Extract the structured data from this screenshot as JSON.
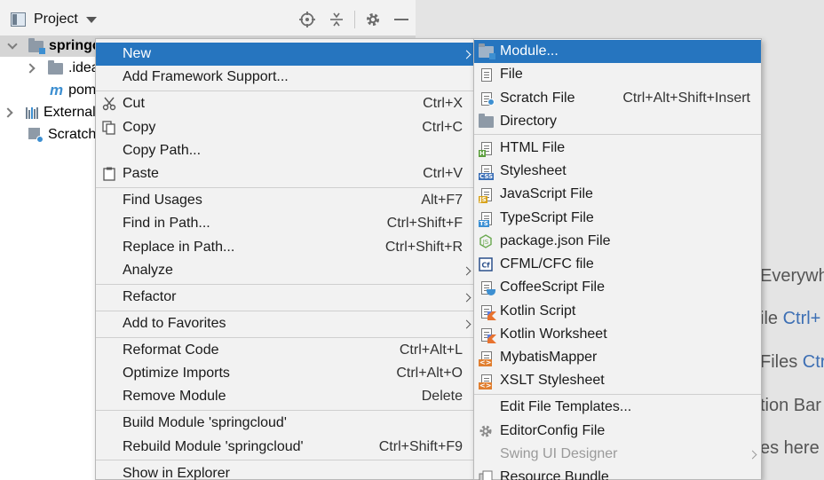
{
  "panel": {
    "title": "Project"
  },
  "tree": [
    {
      "label": "springcloud",
      "bold": true
    },
    {
      "label": ".idea"
    },
    {
      "label": "pom"
    },
    {
      "label": "External"
    },
    {
      "label": "Scratch"
    }
  ],
  "hints": [
    {
      "text": "Everywh",
      "key": ""
    },
    {
      "text": "ile ",
      "key": "Ctrl+"
    },
    {
      "text": "Files ",
      "key": "Ctr"
    },
    {
      "text": "tion Bar",
      "key": ""
    },
    {
      "text": "es here",
      "key": ""
    }
  ],
  "context_menu": {
    "items": [
      {
        "label": "New",
        "shortcut": "",
        "submenu": true,
        "highlighted": true
      },
      {
        "label": "Add Framework Support...",
        "shortcut": ""
      },
      {
        "label": "Cut",
        "shortcut": "Ctrl+X",
        "icon": "scissors-icon"
      },
      {
        "label": "Copy",
        "shortcut": "Ctrl+C",
        "icon": "copy-icon"
      },
      {
        "label": "Copy Path...",
        "shortcut": ""
      },
      {
        "label": "Paste",
        "shortcut": "Ctrl+V",
        "icon": "clipboard-icon"
      },
      {
        "label": "Find Usages",
        "shortcut": "Alt+F7"
      },
      {
        "label": "Find in Path...",
        "shortcut": "Ctrl+Shift+F"
      },
      {
        "label": "Replace in Path...",
        "shortcut": "Ctrl+Shift+R"
      },
      {
        "label": "Analyze",
        "shortcut": "",
        "submenu": true
      },
      {
        "label": "Refactor",
        "shortcut": "",
        "submenu": true
      },
      {
        "label": "Add to Favorites",
        "shortcut": "",
        "submenu": true
      },
      {
        "label": "Reformat Code",
        "shortcut": "Ctrl+Alt+L"
      },
      {
        "label": "Optimize Imports",
        "shortcut": "Ctrl+Alt+O"
      },
      {
        "label": "Remove Module",
        "shortcut": "Delete"
      },
      {
        "label": "Build Module 'springcloud'",
        "shortcut": ""
      },
      {
        "label": "Rebuild Module 'springcloud'",
        "shortcut": "Ctrl+Shift+F9"
      },
      {
        "label": "Show in Explorer",
        "shortcut": ""
      }
    ]
  },
  "new_submenu": {
    "items": [
      {
        "label": "Module...",
        "shortcut": "",
        "highlighted": true,
        "icon": "module-folder-icon"
      },
      {
        "label": "File",
        "shortcut": "",
        "icon": "file-icon"
      },
      {
        "label": "Scratch File",
        "shortcut": "Ctrl+Alt+Shift+Insert",
        "icon": "scratch-file-icon"
      },
      {
        "label": "Directory",
        "shortcut": "",
        "icon": "folder-icon"
      },
      {
        "label": "HTML File",
        "shortcut": "",
        "icon": "html-file-icon",
        "tag": "H"
      },
      {
        "label": "Stylesheet",
        "shortcut": "",
        "icon": "css-file-icon",
        "tag": "CSS"
      },
      {
        "label": "JavaScript File",
        "shortcut": "",
        "icon": "js-file-icon",
        "tag": "JS"
      },
      {
        "label": "TypeScript File",
        "shortcut": "",
        "icon": "ts-file-icon",
        "tag": "TS"
      },
      {
        "label": "package.json File",
        "shortcut": "",
        "icon": "nodejs-icon"
      },
      {
        "label": "CFML/CFC file",
        "shortcut": "",
        "icon": "cfml-icon"
      },
      {
        "label": "CoffeeScript File",
        "shortcut": "",
        "icon": "coffeescript-icon"
      },
      {
        "label": "Kotlin Script",
        "shortcut": "",
        "icon": "kotlin-icon"
      },
      {
        "label": "Kotlin Worksheet",
        "shortcut": "",
        "icon": "kotlin-icon"
      },
      {
        "label": "MybatisMapper",
        "shortcut": "",
        "icon": "xml-icon"
      },
      {
        "label": "XSLT Stylesheet",
        "shortcut": "",
        "icon": "xml-icon"
      },
      {
        "label": "Edit File Templates...",
        "shortcut": ""
      },
      {
        "label": "EditorConfig File",
        "shortcut": "",
        "icon": "gear-icon"
      },
      {
        "label": "Swing UI Designer",
        "shortcut": "",
        "submenu": true,
        "disabled": true
      },
      {
        "label": "Resource Bundle",
        "shortcut": "",
        "icon": "resource-bundle-icon"
      }
    ]
  },
  "colors": {
    "highlight": "#2675bf",
    "menu_bg": "#f2f2f2",
    "link_key": "#3d6fb4"
  }
}
